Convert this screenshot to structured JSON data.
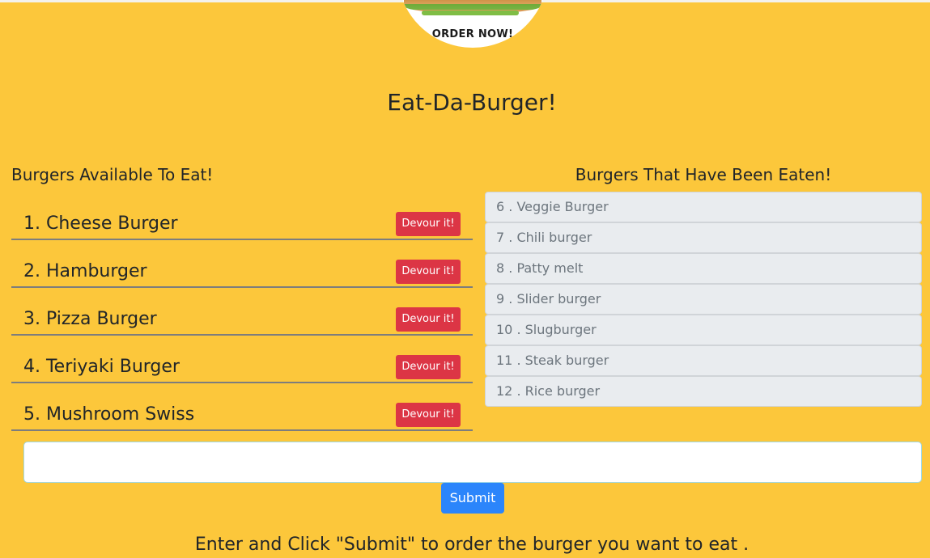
{
  "logo": {
    "text": "ORDER NOW!"
  },
  "page_title": "Eat-Da-Burger!",
  "available": {
    "heading": "Burgers Available To Eat!",
    "items": [
      {
        "label": "1. Cheese Burger",
        "button": "Devour it!"
      },
      {
        "label": "2. Hamburger",
        "button": "Devour it!"
      },
      {
        "label": "3. Pizza Burger",
        "button": "Devour it!"
      },
      {
        "label": "4. Teriyaki Burger",
        "button": "Devour it!"
      },
      {
        "label": "5. Mushroom Swiss",
        "button": "Devour it!"
      }
    ]
  },
  "eaten": {
    "heading": "Burgers That Have Been Eaten!",
    "items": [
      {
        "label": "6 . Veggie Burger"
      },
      {
        "label": "7 . Chili burger"
      },
      {
        "label": "8 . Patty melt"
      },
      {
        "label": "9 . Slider burger"
      },
      {
        "label": "10 . Slugburger"
      },
      {
        "label": "11 . Steak burger"
      },
      {
        "label": "12 . Rice burger"
      }
    ]
  },
  "form": {
    "input_value": "",
    "submit_label": "Submit",
    "instructions": "Enter and Click \"Submit\" to order the burger you want to eat ."
  },
  "colors": {
    "background": "#fcc73b",
    "devour_button": "#dc3545",
    "submit_button": "#2b85fb",
    "eaten_item_bg": "#e9ecef"
  }
}
